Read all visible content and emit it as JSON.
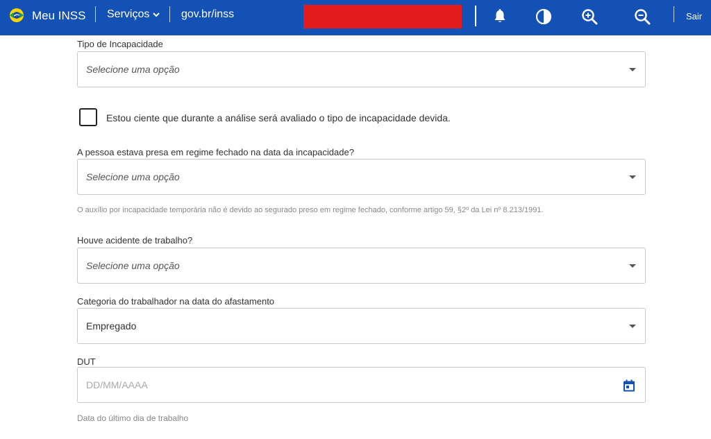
{
  "header": {
    "brand": "Meu INSS",
    "services_menu": "Serviços",
    "gov_link": "gov.br/inss",
    "logout": "Sair",
    "icons": [
      "bell-icon",
      "contrast-icon",
      "zoom-in-icon",
      "zoom-out-icon"
    ],
    "colors": {
      "bar": "#1351b4",
      "redacted": "#e31b1b"
    }
  },
  "form": {
    "incapacity_type": {
      "label": "Tipo de Incapacidade",
      "value": "Selecione uma opção"
    },
    "acknowledge": {
      "label": "Estou ciente que durante a análise será avaliado o tipo de incapacidade devida.",
      "checked": false
    },
    "imprisoned": {
      "label": "A pessoa estava presa em regime fechado na data da incapacidade?",
      "value": "Selecione uma opção",
      "help": "O auxílio por incapacidade temporária não é devido ao segurado preso em regime fechado, conforme artigo 59, §2º da Lei nº 8.213/1991."
    },
    "work_accident": {
      "label": "Houve acidente de trabalho?",
      "value": "Selecione uma opção"
    },
    "worker_category": {
      "label": "Categoria do trabalhador na data do afastamento",
      "value": "Empregado"
    },
    "dut": {
      "label": "DUT",
      "placeholder": "DD/MM/AAAA",
      "help": "Data do último dia de trabalho"
    }
  }
}
